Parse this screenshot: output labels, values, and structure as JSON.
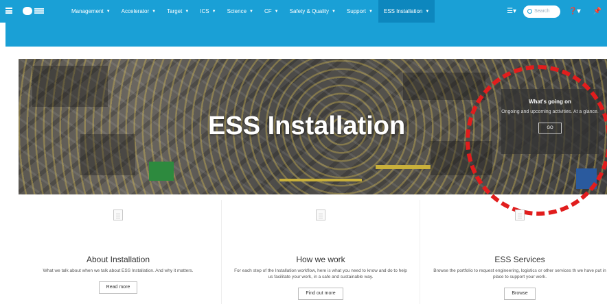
{
  "nav": {
    "menu": [
      {
        "label": "Management"
      },
      {
        "label": "Accelerator"
      },
      {
        "label": "Target"
      },
      {
        "label": "ICS"
      },
      {
        "label": "Science"
      },
      {
        "label": "CF"
      },
      {
        "label": "Safety & Quality"
      },
      {
        "label": "Support"
      },
      {
        "label": "ESS Installation"
      }
    ],
    "search_placeholder": "Search"
  },
  "hero": {
    "title": "ESS Installation",
    "whats_going_on": {
      "heading": "What's going on",
      "text": "Ongoing and upcoming activities. At a glance.",
      "button": "GO"
    }
  },
  "cards": [
    {
      "title": "About Installation",
      "text": "What we talk about when we talk about ESS Installation. And why it matters.",
      "button": "Read more"
    },
    {
      "title": "How we work",
      "text": "For each step of the Installation workflow, here is what you need to know and do to help us facilitate your work, in a safe and sustainable way.",
      "button": "Find out more"
    },
    {
      "title": "ESS Services",
      "text": "Browse the portfolio to request engineering, logistics or other services th we have put in place to support your work.",
      "button": "Browse"
    }
  ],
  "colors": {
    "nav": "#1aa0d6",
    "active_nav": "#0d87be",
    "annotation": "#e11d1d"
  }
}
